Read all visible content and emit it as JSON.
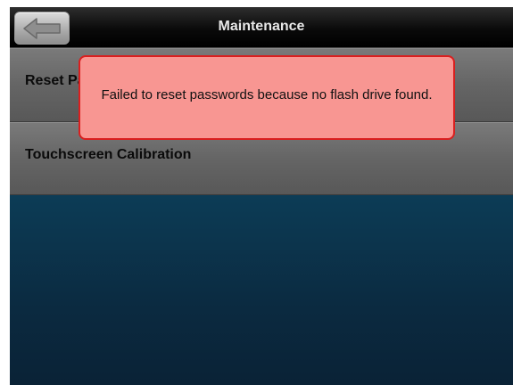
{
  "header": {
    "title": "Maintenance",
    "back_icon": "left-arrow-icon"
  },
  "menu": {
    "items": [
      {
        "label": "Reset Passwords"
      },
      {
        "label": "Touchscreen Calibration"
      }
    ]
  },
  "toast": {
    "message": "Failed to reset passwords because no flash drive found.",
    "background_color": "#f89692",
    "border_color": "#d91f1f"
  }
}
